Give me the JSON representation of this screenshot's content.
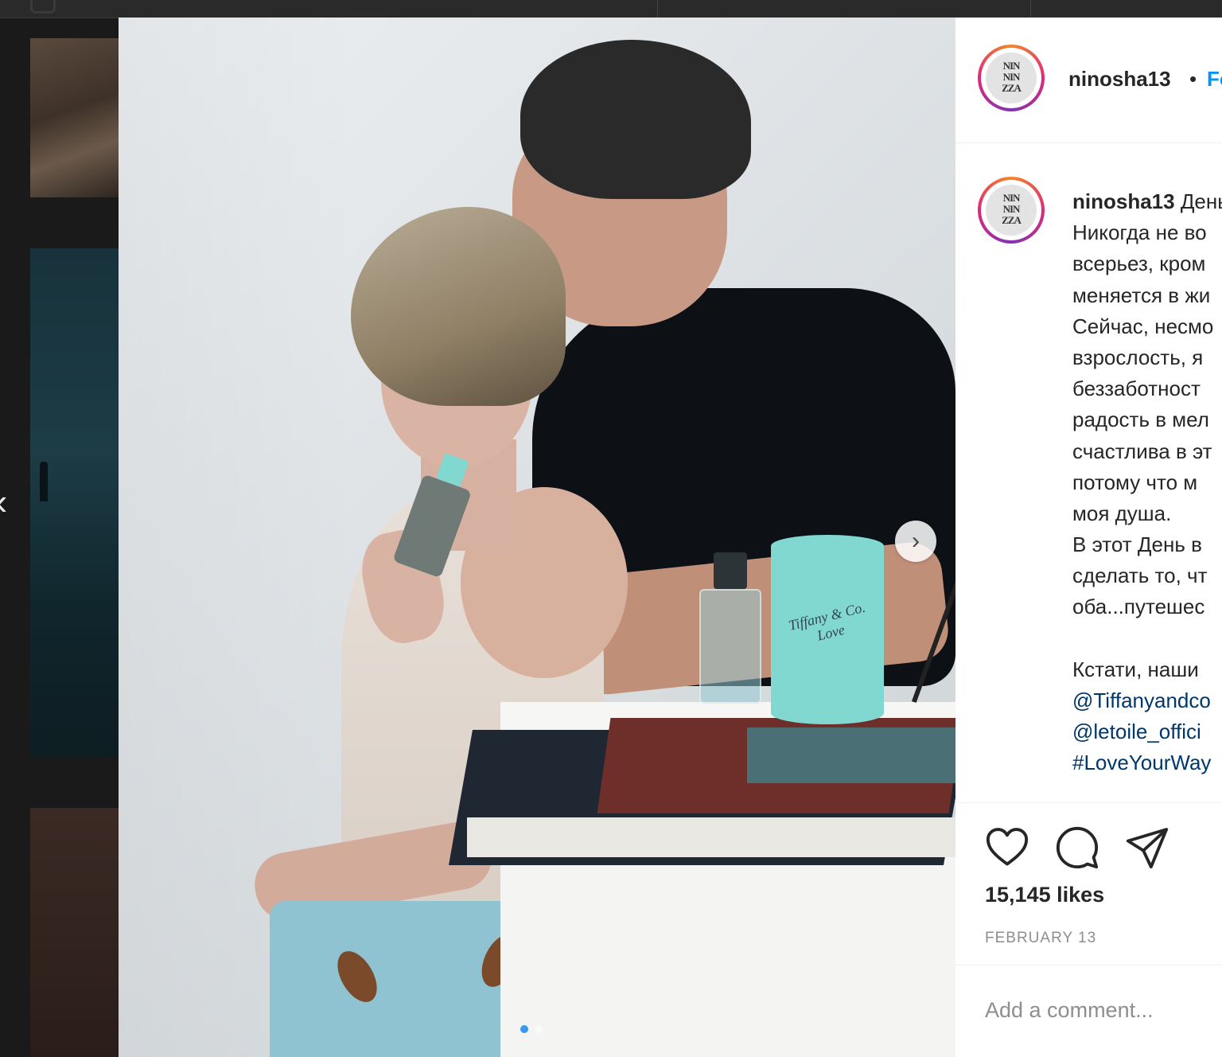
{
  "post": {
    "username": "ninosha13",
    "follow_label": "Follow",
    "avatar_text": "NIN\nNIN\nZZA"
  },
  "caption": {
    "username": "ninosha13",
    "first_line_rest": "День",
    "lines": [
      "Никогда не во",
      "всерьез, кром",
      "меняется в жи",
      "Сейчас, несмо",
      "взрослость, я",
      "беззаботност",
      "радость в мел",
      "счастлива в эт",
      "потому что м",
      "моя душа.",
      "В этот День в",
      "сделать то, чт",
      "оба...путешес",
      "",
      "Кстати, наши"
    ],
    "mentions": [
      "@Tiffanyandco",
      "@letoile_offici",
      "#LoveYourWay"
    ]
  },
  "product": {
    "box_label": "Tiffany & Co. Love"
  },
  "engagement": {
    "likes": "15,145 likes",
    "date": "FEBRUARY 13"
  },
  "comment": {
    "placeholder": "Add a comment..."
  },
  "carousel": {
    "total": 2,
    "active_index": 0
  },
  "icons": {
    "like": "heart-icon",
    "comment": "comment-icon",
    "share": "paper-plane-icon",
    "next": "chevron-right-icon",
    "prev": "chevron-left-icon"
  },
  "colors": {
    "follow_blue": "#0095f6",
    "link_blue": "#00376b",
    "tiffany_blue": "#81d8d0",
    "muted_gray": "#8e8e8e"
  }
}
